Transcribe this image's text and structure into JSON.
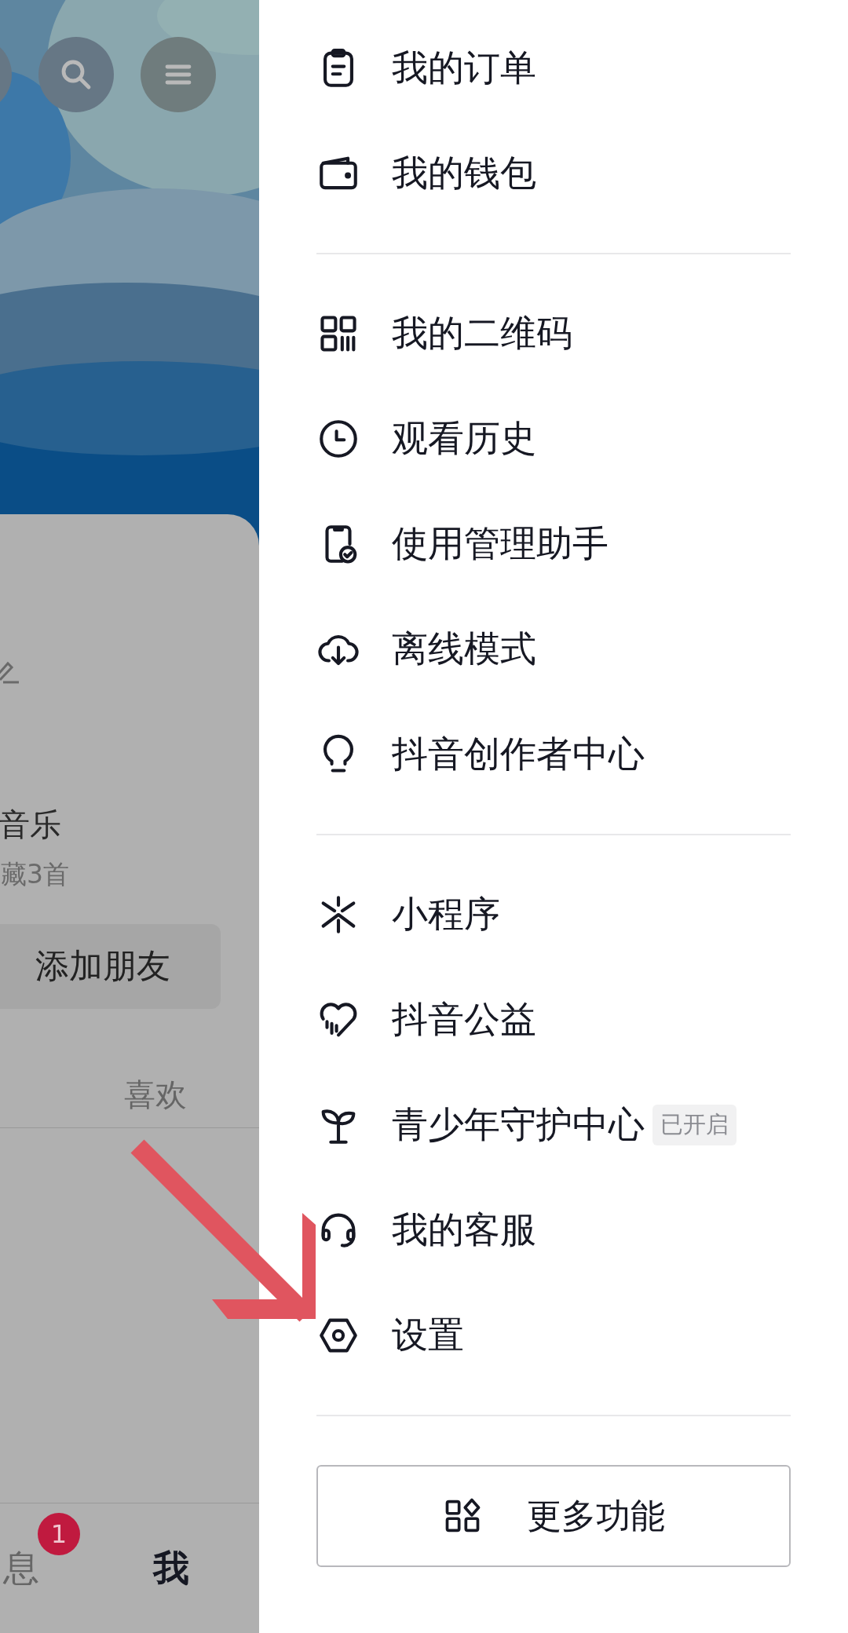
{
  "background_page": {
    "music_title": "音乐",
    "music_count": "藏3首",
    "add_friend_button": "添加朋友",
    "tab_label": "喜欢",
    "bottom_nav": [
      {
        "label": "息",
        "selected": false,
        "badge": "1"
      },
      {
        "label": "我",
        "selected": true
      }
    ]
  },
  "drawer": {
    "groups": [
      {
        "items": [
          {
            "label": "我的订单"
          },
          {
            "label": "我的钱包"
          }
        ]
      },
      {
        "items": [
          {
            "label": "我的二维码"
          },
          {
            "label": "观看历史"
          },
          {
            "label": "使用管理助手"
          },
          {
            "label": "离线模式"
          },
          {
            "label": "抖音创作者中心"
          }
        ]
      },
      {
        "items": [
          {
            "label": "小程序"
          },
          {
            "label": "抖音公益"
          },
          {
            "label": "青少年守护中心",
            "badge": "已开启"
          },
          {
            "label": "我的客服"
          },
          {
            "label": "设置"
          }
        ]
      }
    ],
    "more_button": "更多功能"
  }
}
